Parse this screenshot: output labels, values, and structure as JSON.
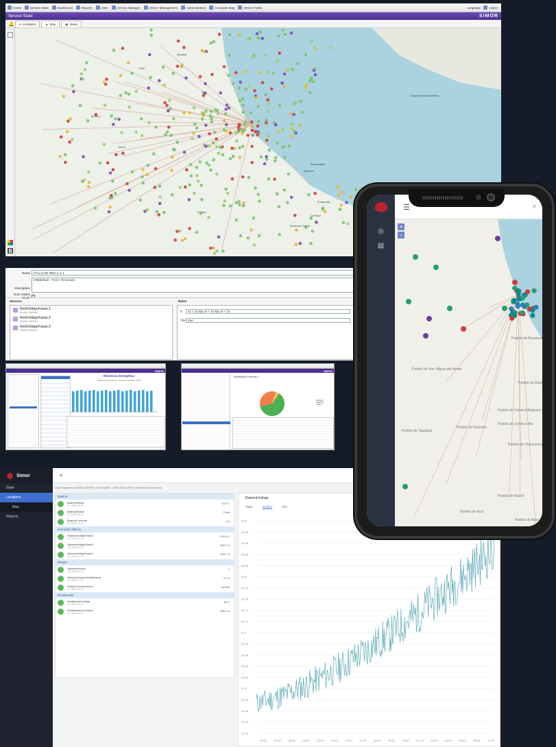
{
  "service_state": {
    "menu": [
      "Home",
      "Service State",
      "Dashboard",
      "Reports",
      "Sites",
      "Service Manager",
      "Device Management",
      "Administration",
      "Concepts Map",
      "Device Fields"
    ],
    "user": "Language",
    "user2": "Admin",
    "title": "Service State",
    "brand": "SIMOR",
    "tabs": [
      "Locations",
      "Map",
      "Views"
    ],
    "map_labels": [
      "Berazategui",
      "Quilmes",
      "Merlo",
      "Moreno",
      "Pilar",
      "Escobar",
      "Tigre",
      "Ezeiza",
      "Florencio Varela",
      "Colonia del Sacramento",
      "Ensenada",
      "La Plata"
    ]
  },
  "form": {
    "name_label": "Name",
    "name_value": "FALLO DE RED C.A.1",
    "desc_label": "Description",
    "desc_value": "eNBdefault - TASA: El Dorado",
    "sum_label": "Sum Values Mode",
    "sensors_title": "Sensors",
    "rules_title": "Rules",
    "sensors": [
      {
        "name": "RedVoltajeFaseL1",
        "sub": "Modelo: Medidor"
      },
      {
        "name": "RedVoltajeFaseL2",
        "sub": "Modelo: Medidor"
      },
      {
        "name": "RedVoltajeFaseL3",
        "sub": "Modelo: Medidor"
      }
    ],
    "rules": [
      {
        "label": "If",
        "value": "x1 < 10 && x2 < 10 && x3 < 10"
      },
      {
        "label": "Then",
        "value": "true"
      }
    ]
  },
  "mini_a": {
    "title": "Eficiencia Energética",
    "subtitle": "Eficiencia Energética - Consumo Rectifier 2019",
    "brand": "SIMOR"
  },
  "mini_b": {
    "title": "Rectificador Emerson 1",
    "brand": "SIMOR",
    "slices": [
      {
        "label": "Normal",
        "value": 62,
        "color": "#4caf50"
      },
      {
        "label": "Warning",
        "value": 33,
        "color": "#f47c4a"
      },
      {
        "label": "Alarm",
        "value": 5,
        "color": "#f2c14e"
      }
    ]
  },
  "dashboard": {
    "app_name": "Simor",
    "nav": [
      {
        "label": "State",
        "type": "item"
      },
      {
        "label": "Locations",
        "type": "active"
      },
      {
        "label": "Map",
        "type": "sub"
      },
      {
        "label": "Reports",
        "type": "item"
      }
    ],
    "breadcrumb": "Root / Argentina / AMBA NORTE / ESCOBAR - TASA BELAGRO / Rectificador Emerson",
    "groups": [
      {
        "title": "Bateria",
        "entries": [
          {
            "name": "BateriaVoltaje",
            "ts": "3-7-2020 11:14",
            "value": "53.0 V"
          },
          {
            "name": "BateriaEstado",
            "ts": "3-7-2020 11:14",
            "value": "Float"
          },
          {
            "name": "BateriaCorriente",
            "ts": "3-7-2020 11:14",
            "value": "0 A"
          }
        ]
      },
      {
        "title": "Corriente Alterna",
        "entries": [
          {
            "name": "SistemaVoltajeFaseC",
            "ts": "3-7-2020 11:14",
            "value": "226.3 V"
          },
          {
            "name": "SistemaVoltajeFaseB",
            "ts": "3-7-2020 11:14",
            "value": "226.2 V"
          },
          {
            "name": "SistemaVoltajeFaseA",
            "ts": "3-7-2020 11:14",
            "value": "226.7 V"
          }
        ]
      },
      {
        "title": "Estado",
        "entries": [
          {
            "name": "SistemaEstado",
            "ts": "3-7-2020 11:14",
            "value": "1"
          },
          {
            "name": "SistemaCapacidadUtilizada",
            "ts": "3-7-2020 11:14",
            "value": "27 %"
          },
          {
            "name": "EstadoComunicacion",
            "ts": "3-7-2020 11:14",
            "value": "Normal"
          }
        ]
      },
      {
        "title": "Rectificador",
        "entries": [
          {
            "name": "RectificadorVoltaje",
            "ts": "3-7-2020 11:14",
            "value": "54 V"
          },
          {
            "name": "RectificadorCorriente",
            "ts": "3-7-2020 11:14",
            "value": "265.9 A"
          }
        ]
      }
    ],
    "chart_title": "BateriaVoltaje",
    "chart_tabs": [
      "Tabla",
      "Grafico",
      "Info"
    ]
  },
  "chart_data": {
    "type": "line",
    "title": "BateriaVoltaje",
    "ylim": [
      53.52,
      53.9
    ],
    "yticks": [
      "53.9",
      "53.88",
      "53.86",
      "53.84",
      "53.82",
      "53.8",
      "53.78",
      "53.76",
      "53.74",
      "53.72",
      "53.7",
      "53.68",
      "53.66",
      "53.64",
      "53.62",
      "53.6",
      "53.58",
      "53.56",
      "53.54",
      "53.52"
    ],
    "xticks": [
      "02:00",
      "04:00",
      "06:00",
      "08:00",
      "10:00",
      "12:00",
      "14:00",
      "16:00",
      "18:00",
      "20:00",
      "22:00",
      "07 Jul",
      "02:00",
      "04:00",
      "06:00",
      "08:00",
      "10:00"
    ],
    "series": [
      {
        "trend_start": 53.575,
        "trend_end": 53.85,
        "noise": 0.025,
        "color": "#5aa9b7"
      }
    ]
  },
  "phone": {
    "map_labels": [
      "Partido de Brandsen",
      "Partido de General Belgrano",
      "Partido de San Miguel del Monte",
      "Partido de Chascomús",
      "Partido de Ranchos",
      "Partido de General Paz",
      "Partido de Magdalena",
      "Partido de Azul",
      "Partido de Ayacucho",
      "Partido de Rauch",
      "Partido de Tapalqué"
    ]
  }
}
